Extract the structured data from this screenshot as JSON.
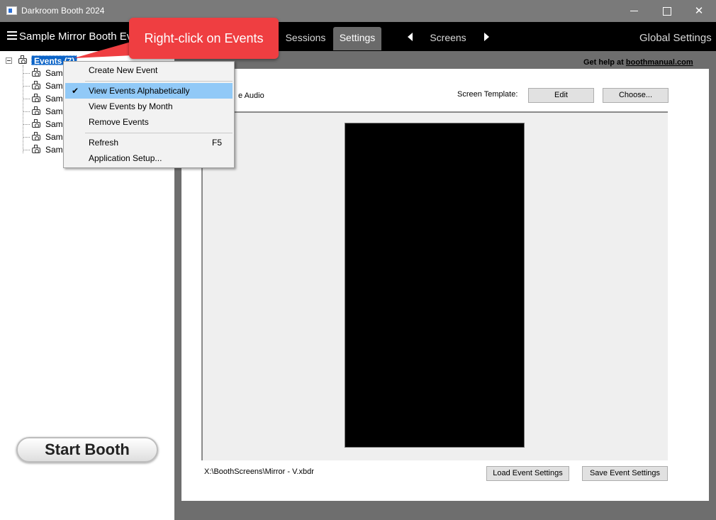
{
  "window": {
    "title": "Darkroom Booth 2024",
    "controls": [
      "minimize",
      "maximize",
      "close"
    ]
  },
  "navbar": {
    "menu_icon": "hamburger-icon",
    "event_name": "Sample Mirror Booth Eve",
    "tabs": [
      {
        "label": "Sessions",
        "active": false
      },
      {
        "label": "Settings",
        "active": true
      }
    ],
    "screens_label": "Screens",
    "global_settings": "Global Settings"
  },
  "tree": {
    "root_label": "Events (7)",
    "items": [
      "Samp",
      "Samp",
      "Samp",
      "Samp",
      "Samp",
      "Samp",
      "Samp"
    ]
  },
  "help": {
    "prefix": "Get help at ",
    "link": "boothmanual.com"
  },
  "settings": {
    "audio_label": "e Audio",
    "screen_template_label": "Screen Template:",
    "edit_button": "Edit",
    "choose_button": "Choose...",
    "file_path": "X:\\BoothScreens\\Mirror - V.xbdr",
    "load_button": "Load Event Settings",
    "save_button": "Save Event Settings"
  },
  "context_menu": {
    "items": [
      {
        "label": "Create New Event"
      },
      {
        "label": "View Events Alphabetically",
        "checked": true
      },
      {
        "label": "View Events by Month"
      },
      {
        "label": "Remove Events"
      },
      {
        "label": "Refresh",
        "shortcut": "F5"
      },
      {
        "label": "Application Setup..."
      }
    ]
  },
  "callout": {
    "text": "Right-click on Events",
    "color": "#ef3e41"
  },
  "start_booth": "Start Booth"
}
